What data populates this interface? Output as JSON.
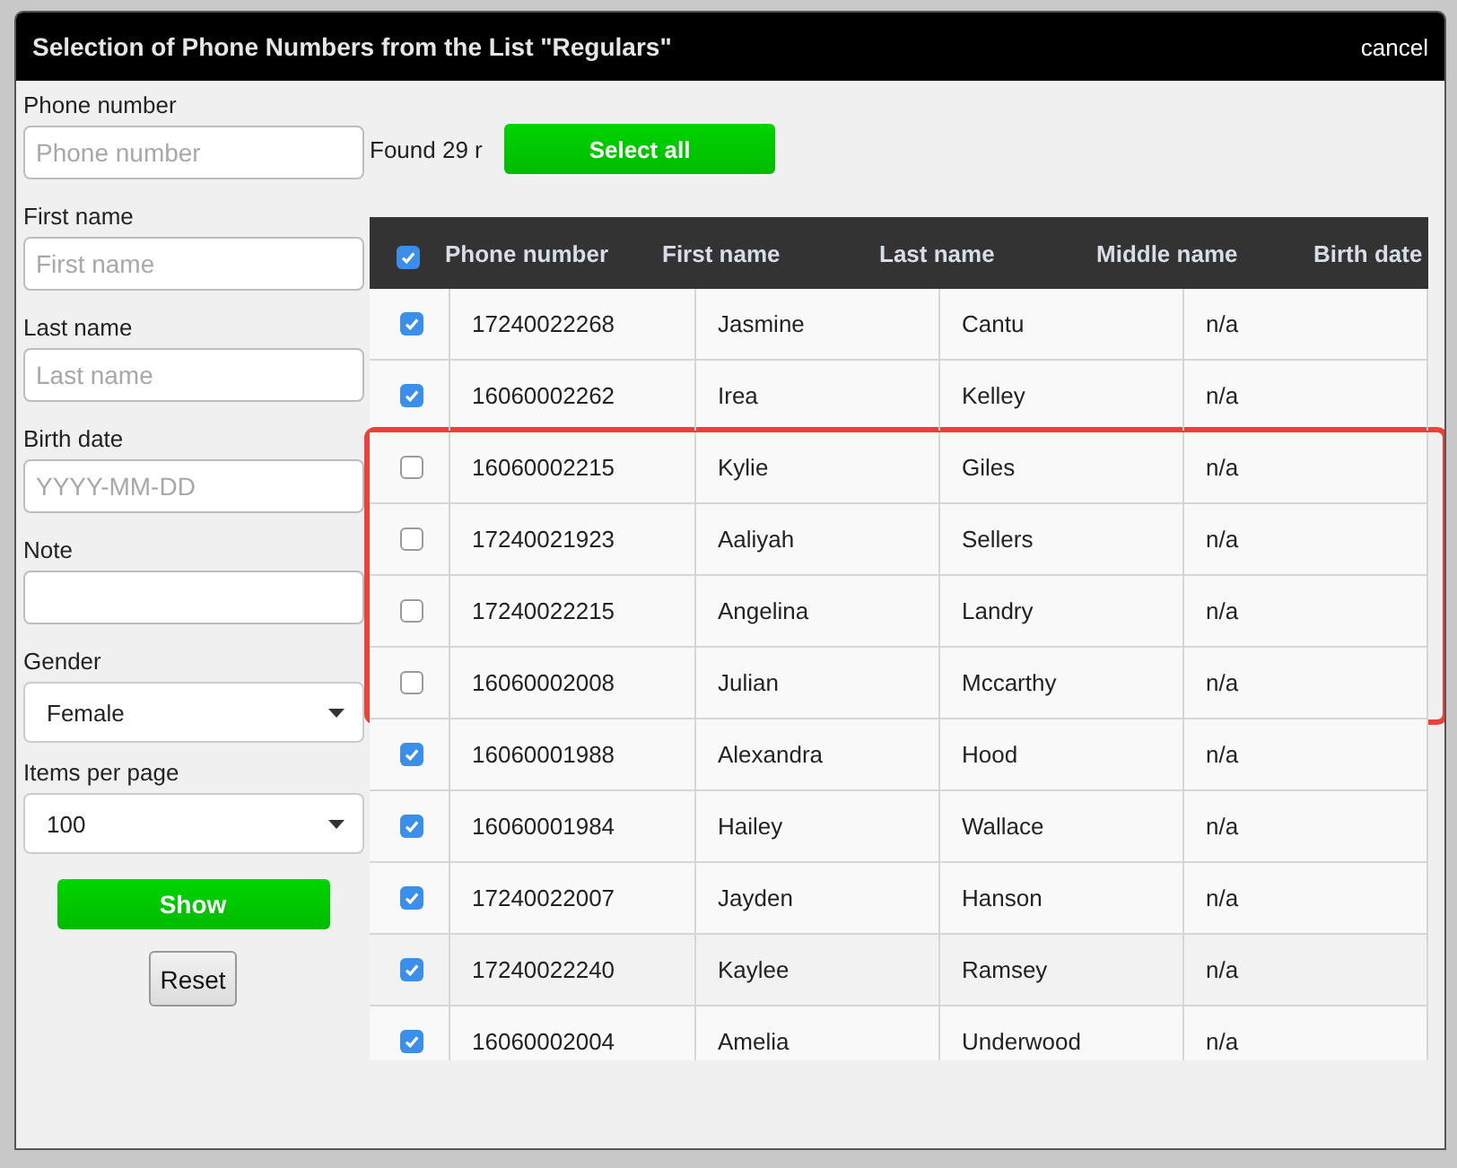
{
  "dialog": {
    "title": "Selection of Phone Numbers from the List \"Regulars\"",
    "close_label": "cancel"
  },
  "filters": [
    {
      "kind": "text",
      "label": "Phone number",
      "placeholder": "Phone number"
    },
    {
      "kind": "text",
      "label": "First name",
      "placeholder": "First name"
    },
    {
      "kind": "text",
      "label": "Last name",
      "placeholder": "Last name"
    },
    {
      "kind": "text",
      "label": "Birth date",
      "placeholder": "YYYY-MM-DD"
    },
    {
      "kind": "text",
      "label": "Note"
    },
    {
      "kind": "select",
      "label": "Gender",
      "value": "Female"
    },
    {
      "kind": "select",
      "label": "Items per page",
      "value": "100"
    }
  ],
  "buttons": {
    "show": "Show",
    "reset": "Reset"
  },
  "found_text": "Found 29 r",
  "select_all": "Select all",
  "table": {
    "all_checked": true,
    "columns": [
      "Phone number",
      "First name",
      "Last name",
      "Middle name",
      "Birth date"
    ],
    "rows": [
      {
        "checked": true,
        "highlighted": false,
        "cells": [
          "17240022268",
          "Jasmine",
          "Cantu",
          "n/a"
        ]
      },
      {
        "checked": true,
        "highlighted": false,
        "cells": [
          "16060002262",
          "Irea",
          "Kelley",
          "n/a"
        ]
      },
      {
        "checked": false,
        "highlighted": true,
        "cells": [
          "16060002215",
          "Kylie",
          "Giles",
          "n/a"
        ]
      },
      {
        "checked": false,
        "highlighted": true,
        "cells": [
          "17240021923",
          "Aaliyah",
          "Sellers",
          "n/a"
        ]
      },
      {
        "checked": false,
        "highlighted": true,
        "cells": [
          "17240022215",
          "Angelina",
          "Landry",
          "n/a"
        ]
      },
      {
        "checked": false,
        "highlighted": true,
        "cells": [
          "16060002008",
          "Julian",
          "Mccarthy",
          "n/a"
        ]
      },
      {
        "checked": true,
        "highlighted": false,
        "cells": [
          "16060001988",
          "Alexandra",
          "Hood",
          "n/a"
        ]
      },
      {
        "checked": true,
        "highlighted": false,
        "cells": [
          "16060001984",
          "Hailey",
          "Wallace",
          "n/a"
        ]
      },
      {
        "checked": true,
        "highlighted": false,
        "cells": [
          "17240022007",
          "Jayden",
          "Hanson",
          "n/a"
        ]
      },
      {
        "checked": true,
        "highlighted": false,
        "cells": [
          "17240022240",
          "Kaylee",
          "Ramsey",
          "n/a"
        ]
      },
      {
        "checked": true,
        "highlighted": false,
        "cells": [
          "16060002004",
          "Amelia",
          "Underwood",
          "n/a"
        ]
      }
    ]
  }
}
